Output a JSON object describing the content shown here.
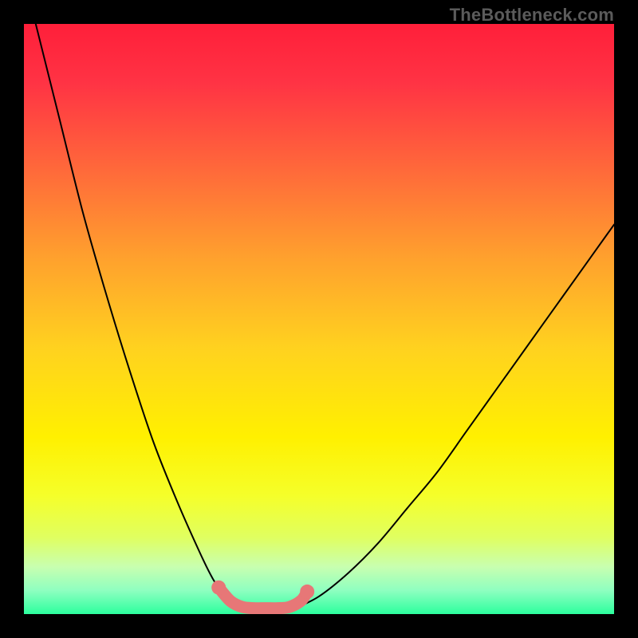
{
  "watermark": "TheBottleneck.com",
  "chart_data": {
    "type": "line",
    "title": "",
    "xlabel": "",
    "ylabel": "",
    "xlim": [
      0,
      100
    ],
    "ylim": [
      0,
      100
    ],
    "grid": false,
    "legend": false,
    "annotations": [],
    "series": [
      {
        "name": "left-curve",
        "x": [
          2,
          6,
          10,
          14,
          18,
          22,
          26,
          30,
          32,
          34,
          36
        ],
        "y": [
          100,
          84,
          68,
          54,
          41,
          29,
          19,
          10,
          6,
          3,
          1
        ]
      },
      {
        "name": "right-curve",
        "x": [
          46,
          50,
          55,
          60,
          65,
          70,
          75,
          80,
          85,
          90,
          95,
          100
        ],
        "y": [
          1,
          3,
          7,
          12,
          18,
          24,
          31,
          38,
          45,
          52,
          59,
          66
        ]
      },
      {
        "name": "pink-bottom-segment",
        "x": [
          33,
          35,
          37,
          39,
          41,
          43,
          45,
          47,
          48
        ],
        "y": [
          4.5,
          2.2,
          1.2,
          1.0,
          1.0,
          1.0,
          1.2,
          2.3,
          3.8
        ]
      }
    ],
    "gradient_stops": [
      {
        "offset": 0.0,
        "color": "#ff1f3a"
      },
      {
        "offset": 0.1,
        "color": "#ff3344"
      },
      {
        "offset": 0.25,
        "color": "#ff6a3a"
      },
      {
        "offset": 0.4,
        "color": "#ffa22d"
      },
      {
        "offset": 0.55,
        "color": "#ffd21f"
      },
      {
        "offset": 0.7,
        "color": "#fff000"
      },
      {
        "offset": 0.8,
        "color": "#f5ff2a"
      },
      {
        "offset": 0.87,
        "color": "#e0ff60"
      },
      {
        "offset": 0.92,
        "color": "#c8ffb0"
      },
      {
        "offset": 0.96,
        "color": "#8effc0"
      },
      {
        "offset": 1.0,
        "color": "#2cff9e"
      }
    ],
    "pink_color": "#e77777",
    "curve_color": "#000000"
  }
}
